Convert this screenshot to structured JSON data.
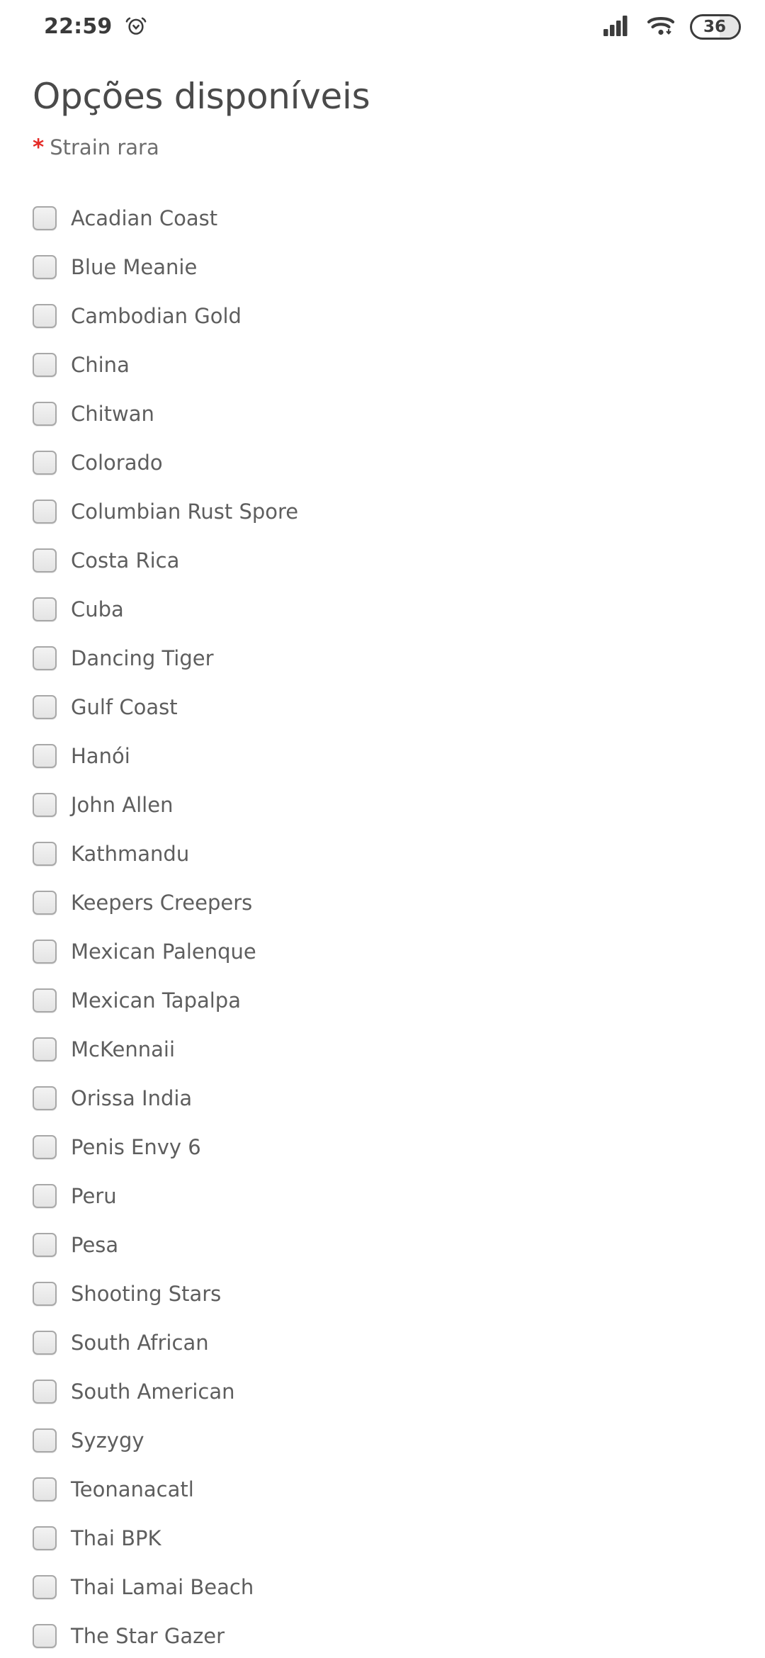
{
  "status_bar": {
    "time": "22:59",
    "alarm_icon": "alarm-clock-icon",
    "signal_icon": "cellular-signal-icon",
    "wifi_icon": "wifi-icon",
    "battery_level": "36"
  },
  "header": {
    "title": "Opções disponíveis",
    "required_marker": "*",
    "field_label": "Strain rara"
  },
  "options": [
    {
      "label": "Acadian Coast",
      "checked": false
    },
    {
      "label": "Blue Meanie",
      "checked": false
    },
    {
      "label": "Cambodian Gold",
      "checked": false
    },
    {
      "label": "China",
      "checked": false
    },
    {
      "label": "Chitwan",
      "checked": false
    },
    {
      "label": "Colorado",
      "checked": false
    },
    {
      "label": "Columbian Rust Spore",
      "checked": false
    },
    {
      "label": "Costa Rica",
      "checked": false
    },
    {
      "label": "Cuba",
      "checked": false
    },
    {
      "label": "Dancing Tiger",
      "checked": false
    },
    {
      "label": "Gulf Coast",
      "checked": false
    },
    {
      "label": "Hanói",
      "checked": false
    },
    {
      "label": "John Allen",
      "checked": false
    },
    {
      "label": "Kathmandu",
      "checked": false
    },
    {
      "label": "Keepers Creepers",
      "checked": false
    },
    {
      "label": "Mexican Palenque",
      "checked": false
    },
    {
      "label": "Mexican Tapalpa",
      "checked": false
    },
    {
      "label": "McKennaii",
      "checked": false
    },
    {
      "label": "Orissa India",
      "checked": false
    },
    {
      "label": "Penis Envy 6",
      "checked": false
    },
    {
      "label": "Peru",
      "checked": false
    },
    {
      "label": "Pesa",
      "checked": false
    },
    {
      "label": "Shooting Stars",
      "checked": false
    },
    {
      "label": "South African",
      "checked": false
    },
    {
      "label": "South American",
      "checked": false
    },
    {
      "label": "Syzygy",
      "checked": false
    },
    {
      "label": "Teonanacatl",
      "checked": false
    },
    {
      "label": "Thai BPK",
      "checked": false
    },
    {
      "label": "Thai Lamai Beach",
      "checked": false
    },
    {
      "label": "The Star Gazer",
      "checked": false
    }
  ],
  "colors": {
    "required_red": "#e52b27",
    "title_gray": "#4a4a4a",
    "label_gray": "#5e6e6e",
    "status_dark": "#3c3c3c",
    "checkbox_border": "#a8a8a8"
  }
}
